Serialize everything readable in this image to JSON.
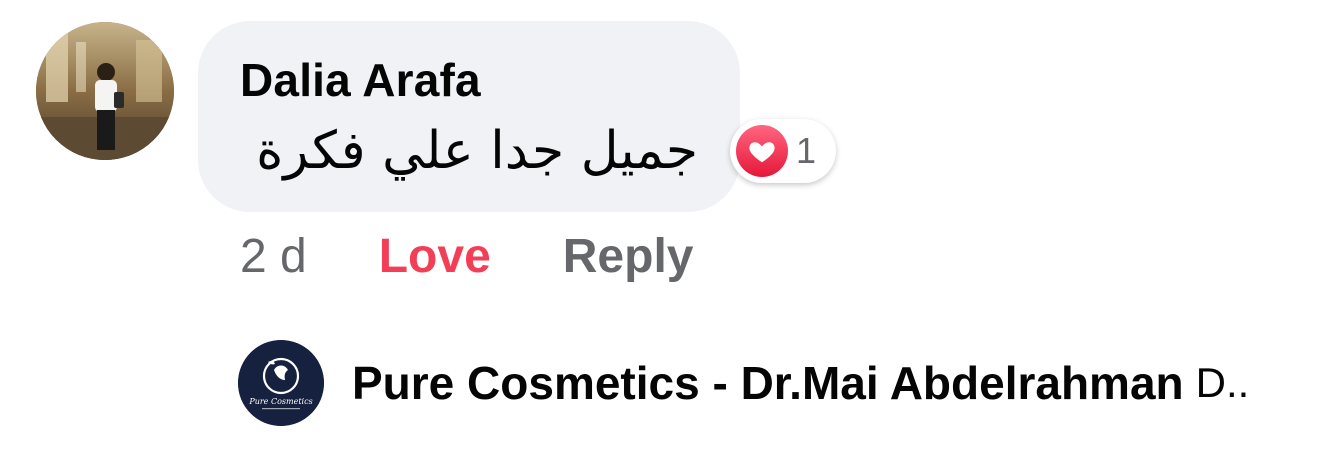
{
  "comment": {
    "author": "Dalia Arafa",
    "text": "جميل جدا علي فكرة",
    "reaction": {
      "icon": "heart-icon",
      "count": "1",
      "color": "#f33e58"
    },
    "actions": {
      "time": "2 d",
      "love_label": "Love",
      "reply_label": "Reply"
    }
  },
  "reply": {
    "author": "Pure Cosmetics - Dr.Mai Abdelrahman",
    "snippet": "D..",
    "avatar_text": "Pure Cosmetics"
  },
  "colors": {
    "bubble": "#f0f2f5",
    "secondary_text": "#65676b",
    "love": "#f33e58"
  }
}
